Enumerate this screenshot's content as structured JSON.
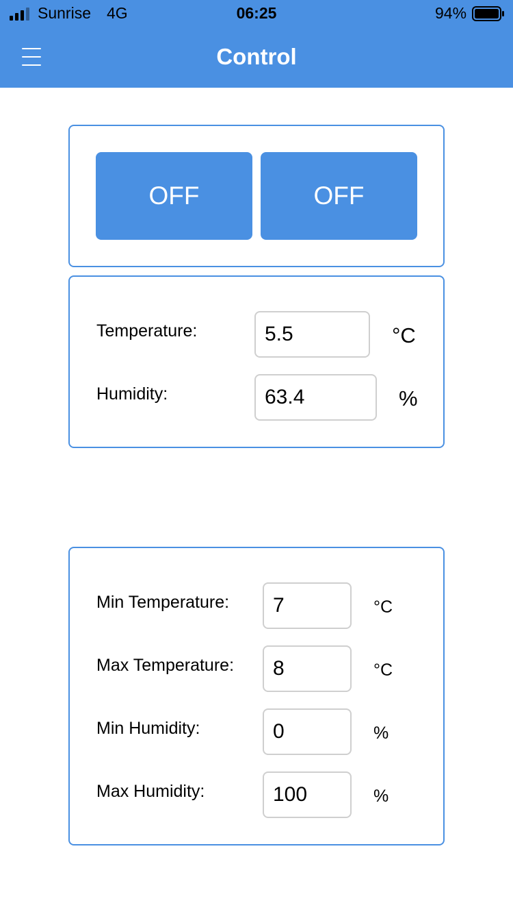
{
  "status_bar": {
    "carrier": "Sunrise",
    "network": "4G",
    "time": "06:25",
    "battery_percent": "94%"
  },
  "nav": {
    "title": "Control",
    "menu_icon": "hamburger-menu-icon"
  },
  "colors": {
    "accent": "#4a90e2",
    "field_border": "#cfcfcf"
  },
  "switches": [
    {
      "label": "OFF"
    },
    {
      "label": "OFF"
    }
  ],
  "readings": {
    "temperature": {
      "label": "Temperature:",
      "value": "5.5",
      "unit": "°C"
    },
    "humidity": {
      "label": "Humidity:",
      "value": "63.4",
      "unit": "%"
    }
  },
  "limits": {
    "min_temperature": {
      "label": "Min Temperature:",
      "value": "7",
      "unit": "°C"
    },
    "max_temperature": {
      "label": "Max Temperature:",
      "value": "8",
      "unit": "°C"
    },
    "min_humidity": {
      "label": "Min Humidity:",
      "value": "0",
      "unit": "%"
    },
    "max_humidity": {
      "label": "Max Humidity:",
      "value": "100",
      "unit": "%"
    }
  }
}
